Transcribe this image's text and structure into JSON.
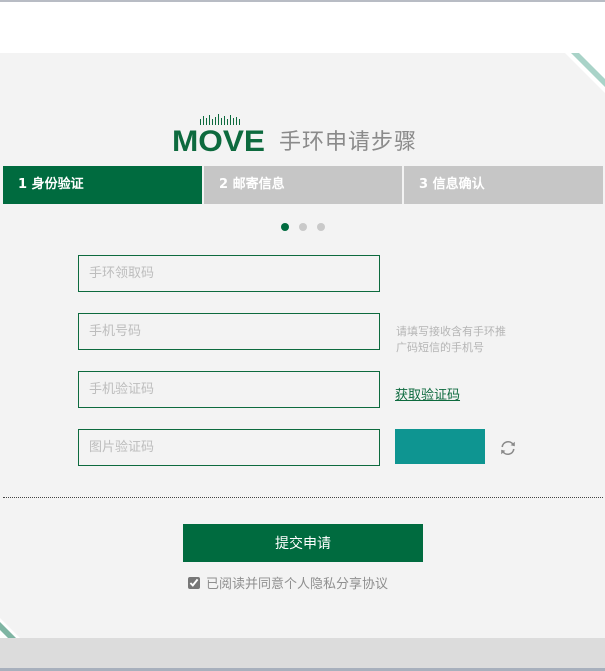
{
  "brand": {
    "logo_text": "MOVE",
    "title": "手环申请步骤"
  },
  "steps": [
    {
      "label": "1 身份验证",
      "active": true
    },
    {
      "label": "2 邮寄信息",
      "active": false
    },
    {
      "label": "3 信息确认",
      "active": false
    }
  ],
  "pager": {
    "total": 3,
    "current": 1
  },
  "form": {
    "band_code": {
      "placeholder": "手环领取码",
      "value": ""
    },
    "phone": {
      "placeholder": "手机号码",
      "value": ""
    },
    "sms_code": {
      "placeholder": "手机验证码",
      "value": ""
    },
    "image_code": {
      "placeholder": "图片验证码",
      "value": ""
    },
    "phone_hint": "请填写接收含有手环推广码短信的手机号",
    "get_code_label": "获取验证码",
    "submit_label": "提交申请",
    "agree_label": "已阅读并同意个人隐私分享协议",
    "agree_checked": true
  },
  "colors": {
    "brand_green": "#006b3f",
    "inactive_step": "#c6c6c6",
    "captcha_teal": "#0e9591",
    "panel_bg": "#f3f3f3"
  },
  "icons": [
    "refresh-icon",
    "checkbox-icon"
  ]
}
